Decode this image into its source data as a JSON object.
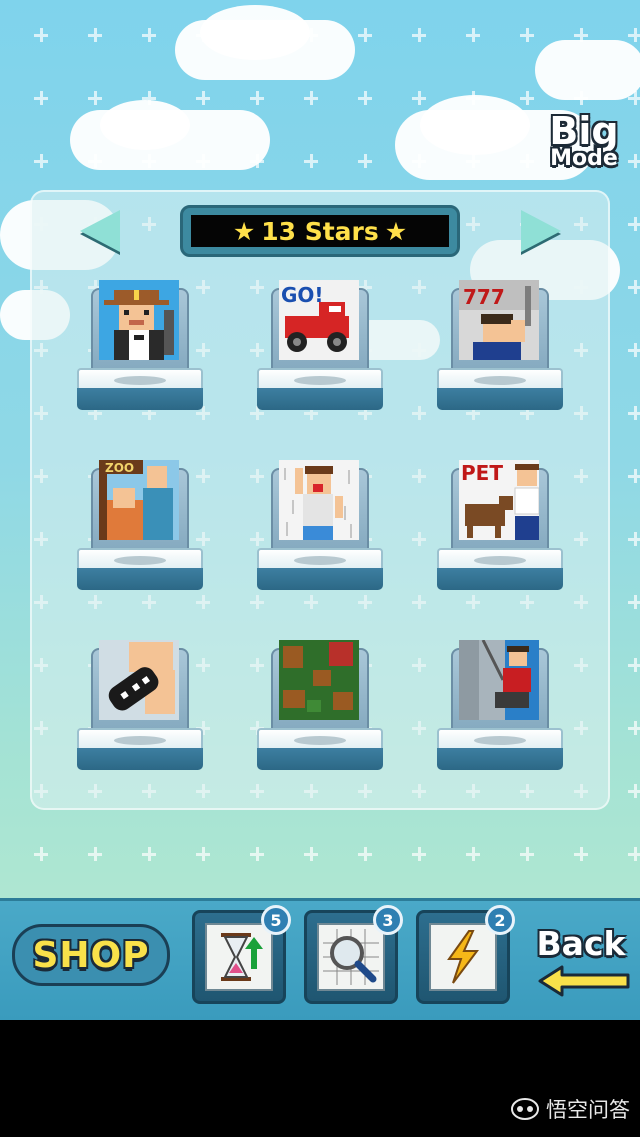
{
  "header": {
    "big_mode_line1": "Big",
    "big_mode_line2": "Mode"
  },
  "stars": {
    "left_star": "★",
    "label": "13 Stars",
    "right_star": "★"
  },
  "levels": [
    {
      "name": "sheriff",
      "sign": ""
    },
    {
      "name": "race-car",
      "sign": "GO!"
    },
    {
      "name": "slot-machine",
      "sign": "777"
    },
    {
      "name": "zoo",
      "sign": "ZOO"
    },
    {
      "name": "rain-man",
      "sign": ""
    },
    {
      "name": "pet-shop",
      "sign": "PET"
    },
    {
      "name": "game-controller",
      "sign": ""
    },
    {
      "name": "forest",
      "sign": ""
    },
    {
      "name": "climber",
      "sign": ""
    }
  ],
  "shop": {
    "label": "SHOP"
  },
  "items": [
    {
      "icon": "hourglass-icon",
      "count": "5"
    },
    {
      "icon": "magnifier-icon",
      "count": "3"
    },
    {
      "icon": "lightning-icon",
      "count": "2"
    }
  ],
  "back": {
    "label": "Back"
  },
  "watermark": {
    "text": "悟空问答"
  },
  "colors": {
    "star_yellow": "#ffe04a",
    "shop_yellow": "#f9e14a",
    "panel_blue": "#3d8aa0"
  }
}
